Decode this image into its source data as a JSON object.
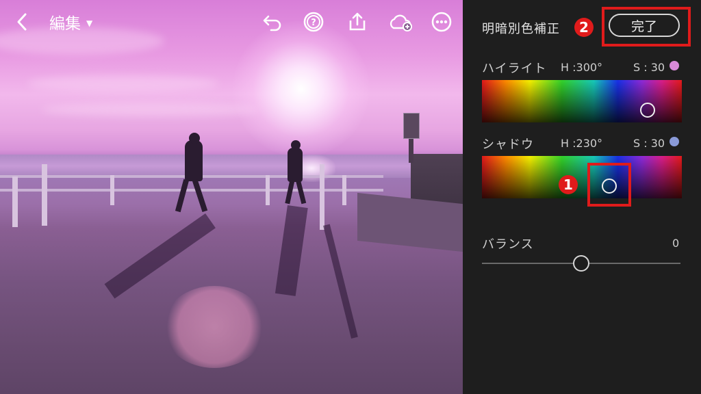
{
  "toolbar": {
    "edit_label": "編集",
    "icons": [
      "back-icon",
      "undo-icon",
      "help-icon",
      "share-icon",
      "cloud-add-icon",
      "more-icon"
    ]
  },
  "panel": {
    "title": "明暗別色補正",
    "done_label": "完了",
    "badge_done": "2",
    "badge_picker": "1",
    "highlight": {
      "label": "ハイライト",
      "hue_text": "H :300°",
      "sat_text": "S : 30",
      "swatch_color": "#d98ad9"
    },
    "shadow": {
      "label": "シャドウ",
      "hue_text": "H :230°",
      "sat_text": "S : 30",
      "swatch_color": "#8a9ad8"
    },
    "balance": {
      "label": "バランス",
      "value": "0"
    }
  },
  "colors": {
    "panel_bg": "#1e1e1e",
    "annotation_red": "#e01b1b"
  }
}
